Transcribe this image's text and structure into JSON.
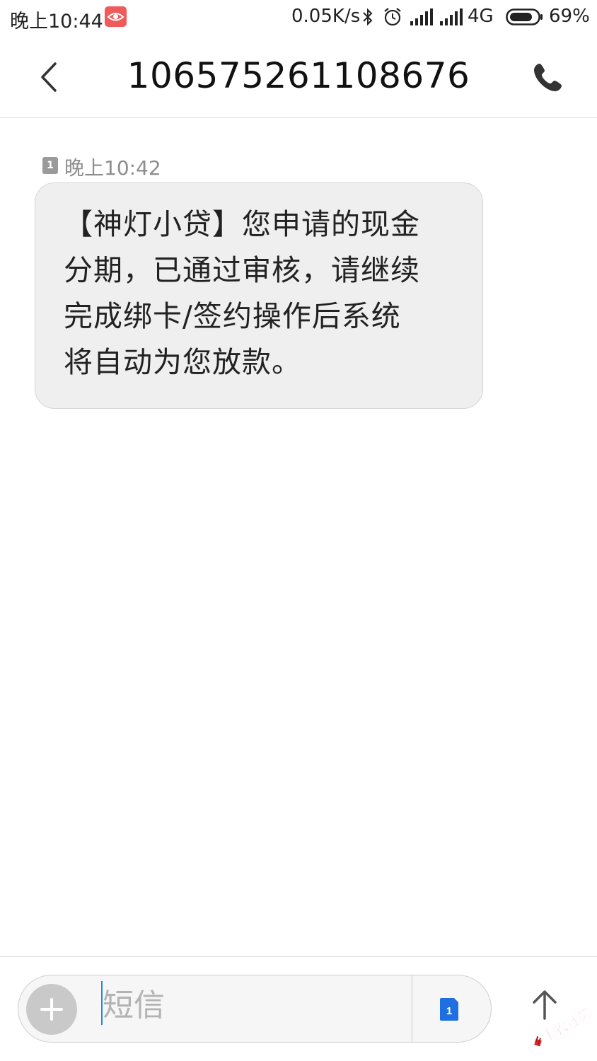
{
  "status_bar": {
    "time": "晚上10:44",
    "speed": "0.05K/s",
    "network": "4G",
    "battery": "69%",
    "icons": [
      "eye-app-icon",
      "bluetooth-icon",
      "alarm-icon",
      "signal-icon",
      "signal-icon",
      "battery-icon"
    ]
  },
  "header": {
    "title": "106575261108676",
    "back_icon": "chevron-left-icon",
    "call_icon": "phone-icon"
  },
  "message": {
    "sim": "1",
    "time": "晚上10:42",
    "lines": [
      "【神灯小贷】您申请的现金",
      "分期，已通过审核，请继续",
      "完成绑卡/签约操作后系统",
      "将自动为您放款。"
    ]
  },
  "composer": {
    "placeholder": "短信",
    "sim": "1",
    "add_icon": "plus-icon",
    "send_icon": "arrow-up-icon"
  },
  "watermark": {
    "text": "卡农社区"
  },
  "colors": {
    "accent": "#2a86e0",
    "sim_blue": "#1f6fe0",
    "bubble": "#efefef",
    "app_icon_red": "#f05a5a"
  }
}
